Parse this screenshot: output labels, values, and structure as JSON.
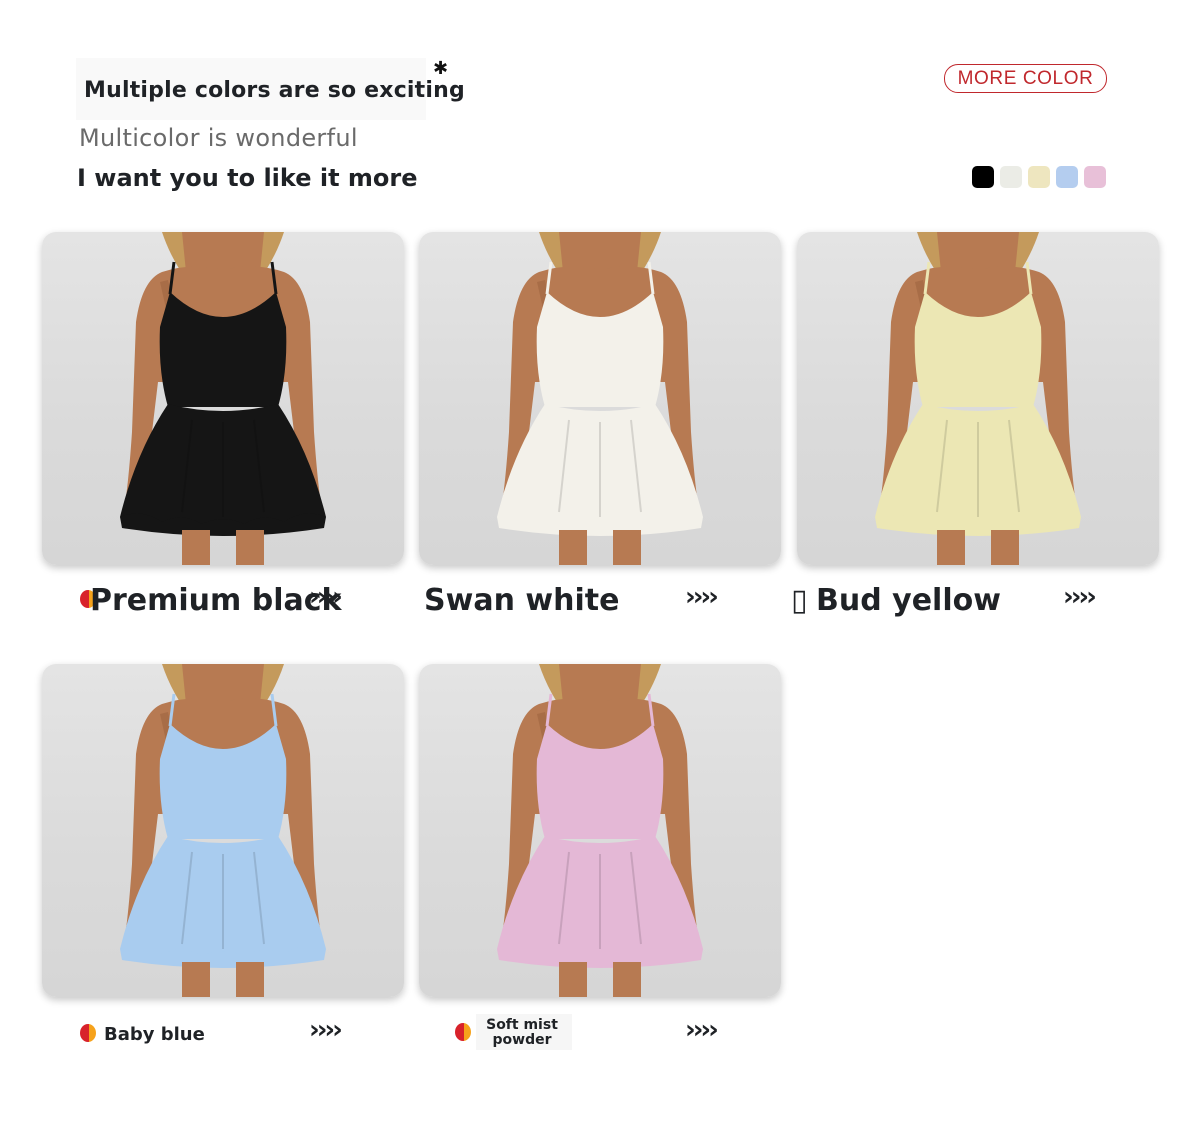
{
  "header": {
    "headline": "Multiple colors are so exciting",
    "subline": "Multicolor is wonderful",
    "tagline": "I want you to like it more",
    "more_color": "MORE COLOR",
    "star": "✱"
  },
  "colors": {
    "accent": "#c0282d",
    "swatches": [
      "#000000",
      "#ebece6",
      "#eee6bf",
      "#b4cdef",
      "#e8c0d8"
    ]
  },
  "products": [
    {
      "name": "Premium black",
      "arrows": "››››",
      "dress_color": "#151515"
    },
    {
      "name": "Swan white",
      "arrows": "››››",
      "dress_color": "#f3f1ea"
    },
    {
      "name": "Bud yellow",
      "prefix": "▯",
      "arrows": "››››",
      "dress_color": "#ece7b4"
    },
    {
      "name": "Baby blue",
      "arrows": "››››",
      "dress_color": "#a9ccef"
    },
    {
      "name_line1": "Soft mist",
      "name_line2": "powder",
      "arrows": "››››",
      "dress_color": "#e4b8d6"
    }
  ]
}
